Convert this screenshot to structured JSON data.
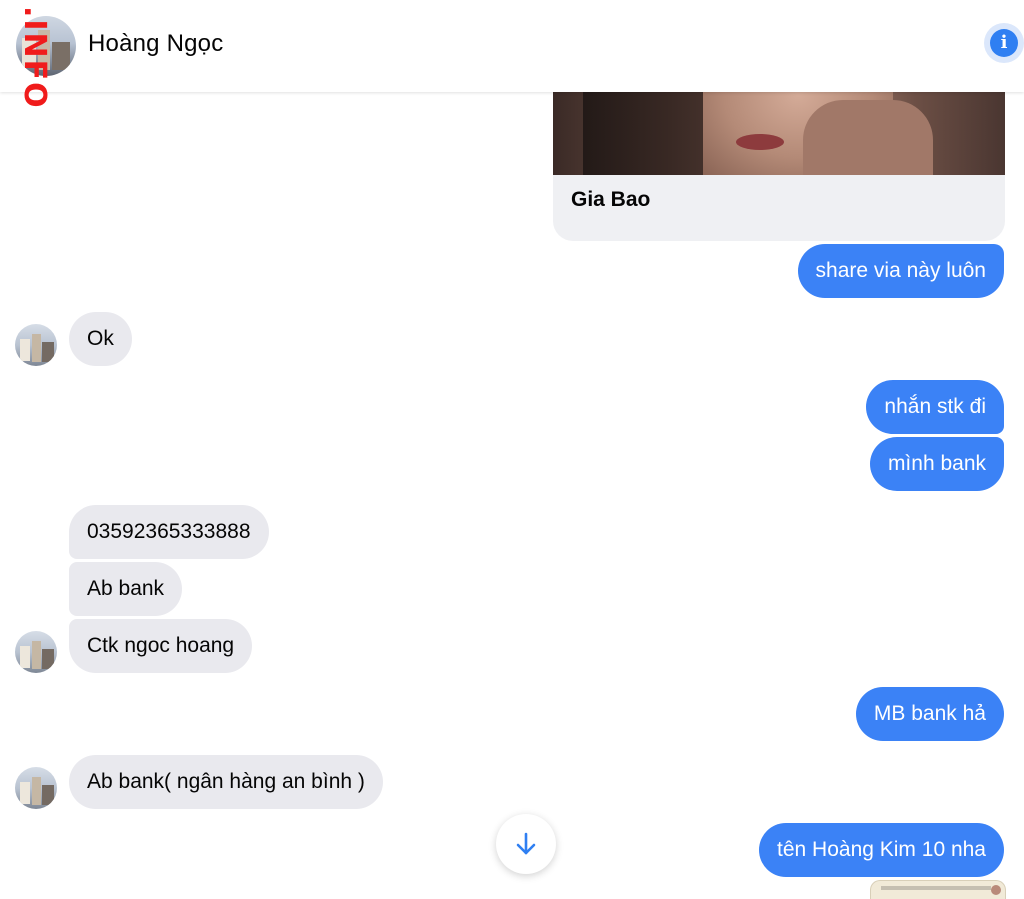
{
  "header": {
    "contact_name": "Hoàng Ngọc",
    "info_icon_glyph": "i",
    "watermark": ".INFO"
  },
  "shared_card": {
    "caption": "Gia Bao"
  },
  "messages": [
    {
      "dir": "out",
      "text": "share via này luôn"
    },
    {
      "dir": "in",
      "text": "Ok"
    },
    {
      "dir": "out",
      "text": "nhắn stk đi"
    },
    {
      "dir": "out",
      "text": "mình bank"
    },
    {
      "dir": "in",
      "text": "03592365333888"
    },
    {
      "dir": "in",
      "text": "Ab bank"
    },
    {
      "dir": "in",
      "text": "Ctk ngoc hoang"
    },
    {
      "dir": "out",
      "text": "MB bank hả"
    },
    {
      "dir": "in",
      "text": "Ab bank( ngân hàng an bình )"
    },
    {
      "dir": "out",
      "text": "tên Hoàng Kim 10 nha"
    }
  ],
  "icons": {
    "info": "info-icon",
    "scroll_down": "arrow-down-icon",
    "avatar": "avatar"
  },
  "colors": {
    "outgoing_bubble": "#3b82f6",
    "incoming_bubble": "#e9e9ee",
    "accent": "#2f7ff2",
    "watermark": "#f01b1b"
  }
}
